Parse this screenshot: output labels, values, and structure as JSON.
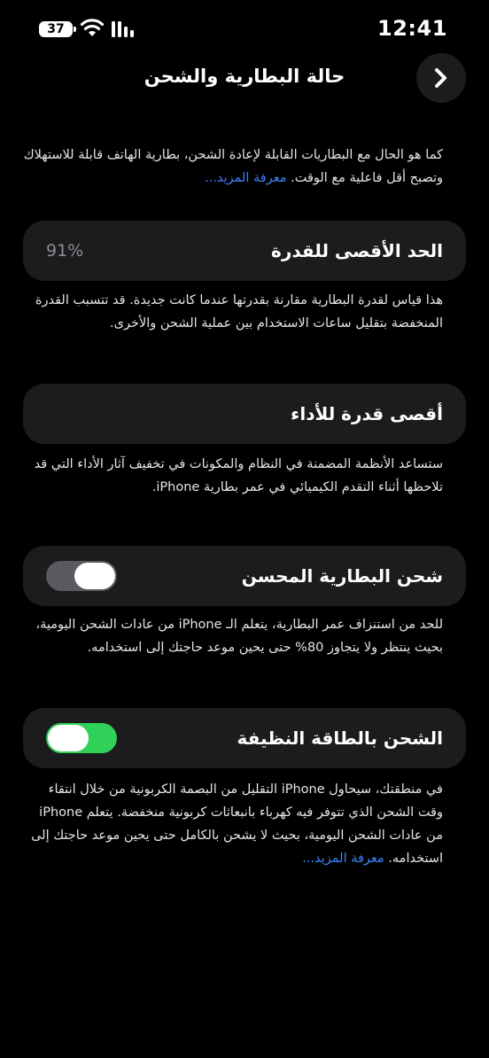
{
  "status_bar": {
    "time": "12:41",
    "battery_level": "37"
  },
  "header": {
    "title": "حالة البطارية والشحن"
  },
  "intro": {
    "text": "كما هو الحال مع البطاريات القابلة لإعادة الشحن، بطارية الهاتف قابلة للاستهلاك وتصبح أقل فاعلية مع الوقت.",
    "link": "معرفة المزيد..."
  },
  "max_capacity": {
    "label": "الحد الأقصى للقدرة",
    "value": "91%",
    "description": "هذا قياس لقدرة البطارية مقارنة بقدرتها عندما كانت جديدة. قد تتسبب القدرة المنخفضة بتقليل ساعات الاستخدام بين عملية الشحن والأخرى."
  },
  "peak_performance": {
    "label": "أقصى قدرة للأداء",
    "description": "ستساعد الأنظمة المضمنة في النظام والمكونات في تخفيف آثار الأداء التي قد تلاحظها أثناء التقدم الكيميائي في عمر بطارية iPhone."
  },
  "optimized_charging": {
    "label": "شحن البطارية المحسن",
    "enabled": false,
    "description": "للحد من استنزاف عمر البطارية، يتعلم الـ iPhone من عادات الشحن اليومية، بحيث ينتظر ولا يتجاوز 80% حتى يحين موعد حاجتك إلى استخدامه."
  },
  "clean_energy": {
    "label": "الشحن بالطاقة النظيفة",
    "enabled": true,
    "description": "في منطقتك، سيحاول iPhone التقليل من البصمة الكربونية من خلال انتقاء وقت الشحن الذي تتوفر فيه كهرباء بانبعاثات كربونية منخفضة. يتعلم iPhone من عادات الشحن اليومية، بحيث لا يشحن بالكامل حتى يحين موعد حاجتك إلى استخدامه.",
    "link": "معرفة المزيد..."
  },
  "colors": {
    "background": "#000000",
    "card": "#1c1c1e",
    "link": "#3b82f6",
    "toggle_on": "#30d158",
    "toggle_off": "#5a5a5e"
  }
}
